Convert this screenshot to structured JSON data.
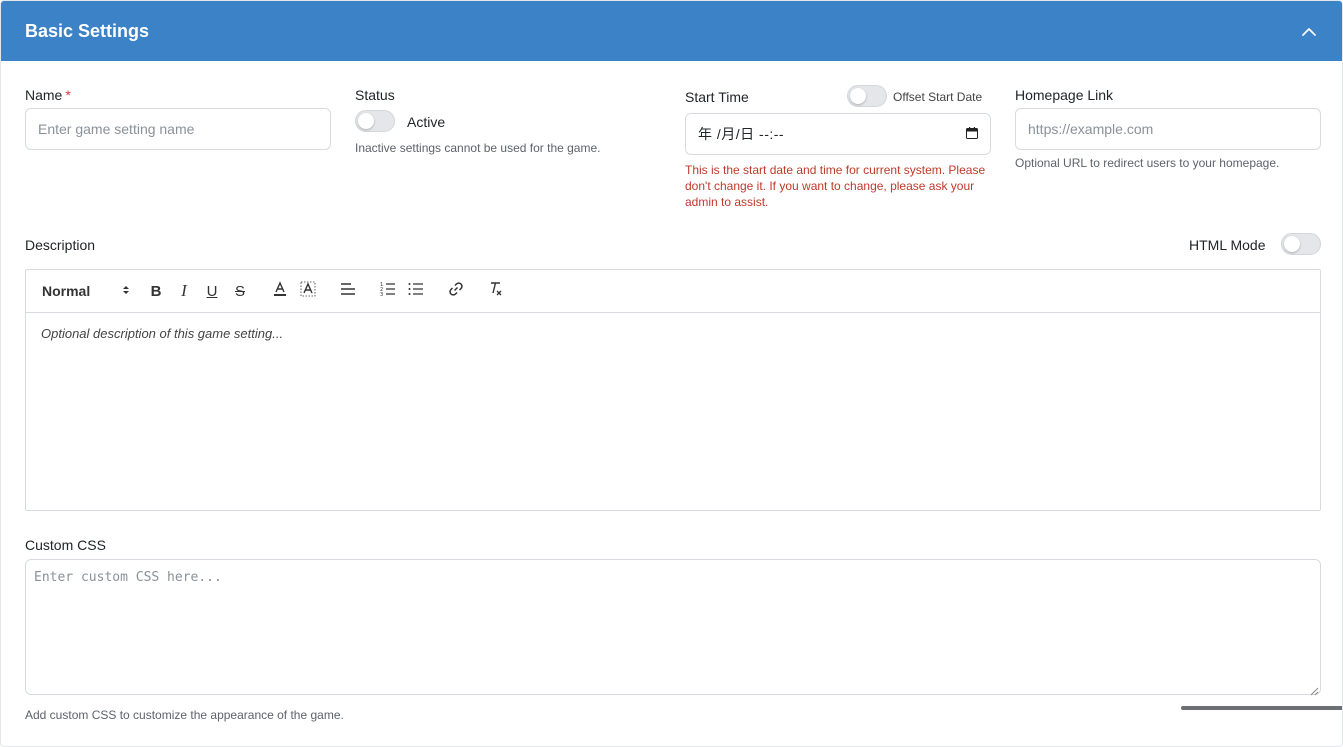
{
  "panel": {
    "title": "Basic Settings",
    "collapse_icon": "chevron-up-icon"
  },
  "name_field": {
    "label": "Name",
    "required_mark": "*",
    "placeholder": "Enter game setting name",
    "value": ""
  },
  "status": {
    "label": "Status",
    "toggle_label": "Active",
    "enabled": false,
    "help": "Inactive settings cannot be used for the game."
  },
  "start_time": {
    "label": "Start Time",
    "offset_label": "Offset Start Date",
    "offset_enabled": false,
    "value": "年 /月/日 --:--",
    "calendar_icon": "calendar-icon",
    "warning": "This is the start date and time for current system. Please don't change it. If you want to change, please ask your admin to assist."
  },
  "homepage": {
    "label": "Homepage Link",
    "placeholder": "https://example.com",
    "value": "",
    "help": "Optional URL to redirect users to your homepage."
  },
  "description": {
    "label": "Description",
    "html_mode_label": "HTML Mode",
    "html_mode_enabled": false,
    "toolbar": {
      "format_select": "Normal",
      "bold": "B",
      "italic": "I",
      "underline": "U",
      "strike": "S",
      "color_icon": "text-color-icon",
      "background_icon": "background-color-icon",
      "align_icon": "align-left-icon",
      "ordered_list_icon": "ordered-list-icon",
      "bullet_list_icon": "bullet-list-icon",
      "link_icon": "link-icon",
      "clean_icon": "clear-format-icon"
    },
    "placeholder": "Optional description of this game setting..."
  },
  "custom_css": {
    "label": "Custom CSS",
    "placeholder": "Enter custom CSS here...",
    "value": "",
    "help": "Add custom CSS to customize the appearance of the game."
  },
  "colors": {
    "header": "#3b82c6",
    "required": "#dc3545",
    "warning": "#c0392b"
  }
}
